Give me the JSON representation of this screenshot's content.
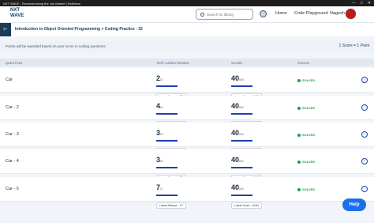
{
  "window": {
    "title": "NXT WAVE - Revolutionizing the Job Market | NxtWave",
    "min": "—",
    "max": "□",
    "close": "✕"
  },
  "nav": {
    "logo_line1": "NXT",
    "logo_line2": "WAVE",
    "search_placeholder": "Search for library",
    "home": "Home",
    "code_playground": "Code Playground",
    "user": "Nagesh"
  },
  "breadcrumb": {
    "toggle": "⊢",
    "text": "Introduction to Object Oriented Programming > Coding Practice - 32"
  },
  "info": {
    "note": "Points will be awarded based on your score in coding questions",
    "formula": "1 Score = 1 Point"
  },
  "table": {
    "headers": {
      "question": "QUESTION",
      "test_cases": "TEST CASES PASSED",
      "score": "SCORE",
      "status": "STATUS"
    },
    "rows": [
      {
        "name": "Car",
        "passed": "2",
        "total": "/2",
        "attempt": "Latest Attempt : 2/2",
        "score": "40",
        "max": "/40",
        "latest_score": "Latest Score : 40/40",
        "status": "SOLVED",
        "tc_progress": 1.0,
        "score_progress": 1.0
      },
      {
        "name": "Car - 2",
        "passed": "4",
        "total": "/4",
        "attempt": "Latest Attempt : 4/4",
        "score": "40",
        "max": "/40",
        "latest_score": "Latest Score : 40/40",
        "status": "SOLVED",
        "tc_progress": 1.0,
        "score_progress": 1.0
      },
      {
        "name": "Car - 3",
        "passed": "3",
        "total": "/3",
        "attempt": "Latest Attempt : 3/3",
        "score": "40",
        "max": "/40",
        "latest_score": "Latest Score : 40/40",
        "status": "SOLVED",
        "tc_progress": 1.0,
        "score_progress": 1.0
      },
      {
        "name": "Car - 4",
        "passed": "3",
        "total": "/3",
        "attempt": "Latest Attempt : 3/3",
        "score": "40",
        "max": "/40",
        "latest_score": "Latest Score : 40/40",
        "status": "SOLVED",
        "tc_progress": 1.0,
        "score_progress": 1.0
      },
      {
        "name": "Car - 5",
        "passed": "7",
        "total": "/7",
        "attempt": "Latest Attempt : 7/7",
        "score": "40",
        "max": "/40",
        "latest_score": "Latest Score : 40/40",
        "status": "SOLVED",
        "tc_progress": 1.0,
        "score_progress": 1.0
      }
    ]
  },
  "help": {
    "label": "Help"
  },
  "colors": {
    "accent": "#1e40af",
    "solved": "#16a34a",
    "help": "#1d6fe8",
    "brand": "#183b56"
  }
}
